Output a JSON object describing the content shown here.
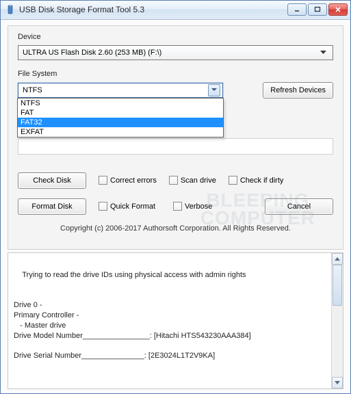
{
  "window": {
    "title": "USB Disk Storage Format Tool 5.3"
  },
  "device": {
    "label": "Device",
    "selected": "ULTRA US  Flash Disk  2.60 (253 MB) (F:\\)"
  },
  "filesystem": {
    "label": "File System",
    "selected": "NTFS",
    "options": [
      "NTFS",
      "FAT",
      "FAT32",
      "EXFAT"
    ],
    "highlighted_index": 2
  },
  "buttons": {
    "refresh": "Refresh Devices",
    "check_disk": "Check Disk",
    "format_disk": "Format Disk",
    "cancel": "Cancel"
  },
  "checkboxes": {
    "correct_errors": "Correct errors",
    "scan_drive": "Scan drive",
    "check_if_dirty": "Check if dirty",
    "quick_format": "Quick Format",
    "verbose": "Verbose"
  },
  "copyright": "Copyright (c) 2006-2017 Authorsoft Corporation. All Rights Reserved.",
  "log": "Trying to read the drive IDs using physical access with admin rights\n\n\nDrive 0 - \nPrimary Controller - \n   - Master drive\nDrive Model Number________________: [Hitachi HTS543230AAA384]\n\nDrive Serial Number_______________: [2E3024L1T2V9KA]",
  "watermark": {
    "line1": "BLEEPING",
    "line2": "COMPUTER"
  }
}
